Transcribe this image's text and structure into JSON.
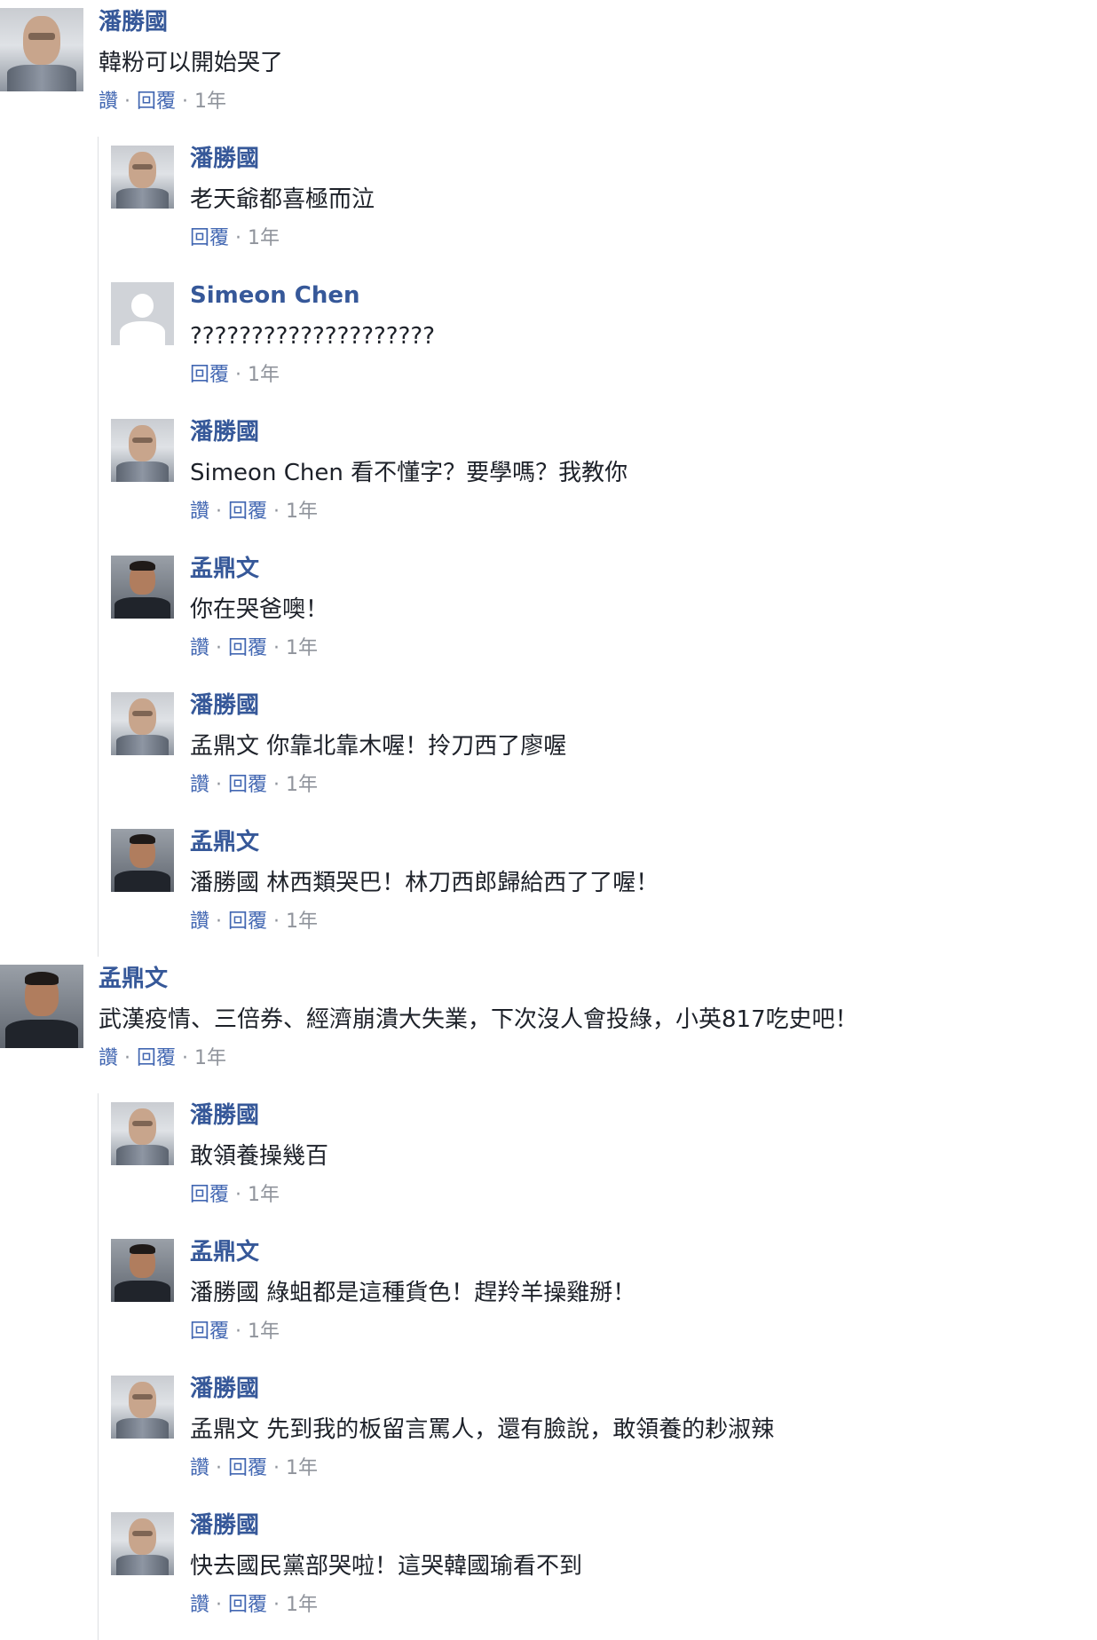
{
  "labels": {
    "like": "讚",
    "reply": "回覆",
    "sep": " · "
  },
  "threads": [
    {
      "comment": {
        "name": "潘勝國",
        "avatar": "avatar-pan",
        "text": "韓粉可以開始哭了",
        "like": true,
        "time": "1年"
      },
      "replies": [
        {
          "name": "潘勝國",
          "avatar": "avatar-pan",
          "text": "老天爺都喜極而泣",
          "like": false,
          "time": "1年"
        },
        {
          "name": "Simeon Chen",
          "avatar": "avatar-default",
          "text": "????????????????????",
          "like": false,
          "time": "1年"
        },
        {
          "name": "潘勝國",
          "avatar": "avatar-pan",
          "text": "Simeon Chen 看不懂字？要學嗎？我教你",
          "like": true,
          "time": "1年"
        },
        {
          "name": "孟鼎文",
          "avatar": "avatar-meng",
          "text": "你在哭爸噢！",
          "like": true,
          "time": "1年"
        },
        {
          "name": "潘勝國",
          "avatar": "avatar-pan",
          "text": "孟鼎文 你靠北靠木喔！拎刀西了廖喔",
          "like": true,
          "time": "1年"
        },
        {
          "name": "孟鼎文",
          "avatar": "avatar-meng",
          "text": "潘勝國 林西類哭巴！林刀西郎歸給西了了喔！",
          "like": true,
          "time": "1年"
        }
      ]
    },
    {
      "comment": {
        "name": "孟鼎文",
        "avatar": "avatar-meng",
        "text": "武漢疫情、三倍券、經濟崩潰大失業，下次沒人會投綠，小英817吃史吧！",
        "like": true,
        "time": "1年"
      },
      "replies": [
        {
          "name": "潘勝國",
          "avatar": "avatar-pan",
          "text": "敢領養操幾百",
          "like": false,
          "time": "1年"
        },
        {
          "name": "孟鼎文",
          "avatar": "avatar-meng",
          "text": "潘勝國 綠蛆都是這種貨色！趕羚羊操雞掰！",
          "like": false,
          "time": "1年"
        },
        {
          "name": "潘勝國",
          "avatar": "avatar-pan",
          "text": "孟鼎文 先到我的板留言罵人，還有臉說，敢領養的耖淑辣",
          "like": true,
          "time": "1年"
        },
        {
          "name": "潘勝國",
          "avatar": "avatar-pan",
          "text": "快去國民黨部哭啦！這哭韓國瑜看不到",
          "like": true,
          "time": "1年"
        }
      ]
    }
  ]
}
